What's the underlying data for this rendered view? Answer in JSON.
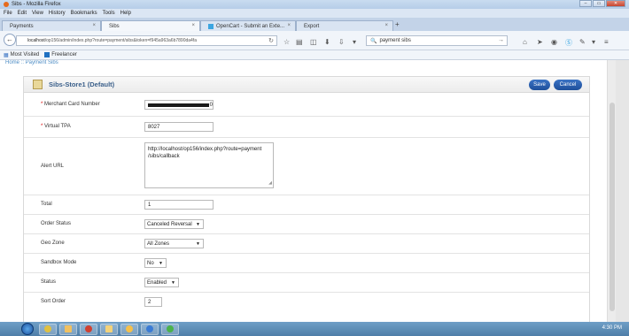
{
  "window": {
    "title": "Sibs - Mozilla Firefox",
    "controls": {
      "minimize": "–",
      "maximize": "▭",
      "close": "✕"
    }
  },
  "menu": [
    "File",
    "Edit",
    "View",
    "History",
    "Bookmarks",
    "Tools",
    "Help"
  ],
  "tabs": [
    {
      "label": "Payments"
    },
    {
      "label": "Sibs"
    },
    {
      "label": "OpenCart - Submit an Exte..."
    },
    {
      "label": "Export"
    }
  ],
  "tab_close": "×",
  "new_tab": "+",
  "address": {
    "host": "localhost",
    "rest": "/op156/admin/index.php?route=payment/sibs&token=f945a963a6b7890da4fa"
  },
  "search": {
    "value": "payment sibs"
  },
  "bookmarks": {
    "most_visited": "Most Visited",
    "freelancer": "Freelancer"
  },
  "breadcrumb": "Home :: Payment Sibs",
  "panel": {
    "title": "Sibs-Store1 (Default)",
    "save": "Save",
    "cancel": "Cancel"
  },
  "fields": {
    "merchant_card": {
      "label": "Merchant Card Number",
      "value_tail": "0"
    },
    "virtual_tpa": {
      "label": "Virtual TPA",
      "value": "8027"
    },
    "alert_url": {
      "label": "Alert URL",
      "line1": "http://localhost/op156/index.php?route=payment",
      "line2": "/sibs/callback"
    },
    "total": {
      "label": "Total",
      "value": "1"
    },
    "order_status": {
      "label": "Order Status",
      "value": "Canceled Reversal"
    },
    "geo_zone": {
      "label": "Geo Zone",
      "value": "All Zones"
    },
    "sandbox": {
      "label": "Sandbox Mode",
      "value": "No"
    },
    "status": {
      "label": "Status",
      "value": "Enabled"
    },
    "sort_order": {
      "label": "Sort Order",
      "value": "2"
    }
  },
  "required_mark": "*",
  "taskbar": {
    "clock": "4:30 PM"
  }
}
